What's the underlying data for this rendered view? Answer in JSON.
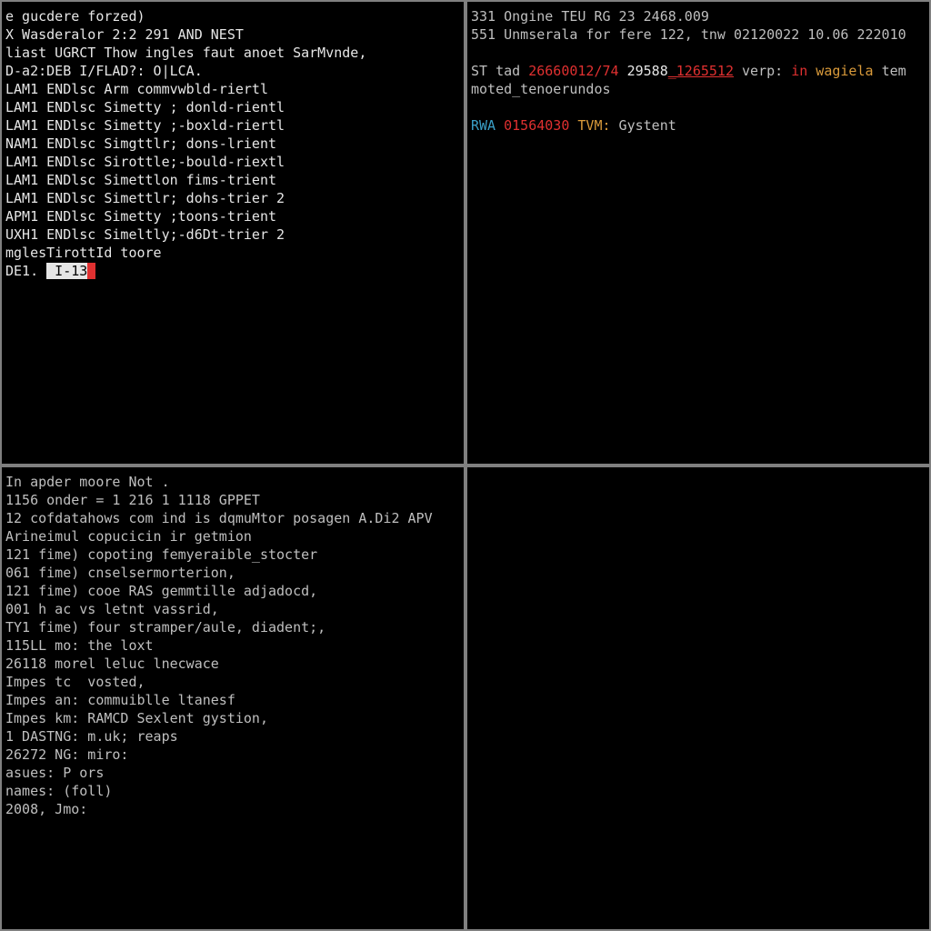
{
  "pane_tl": {
    "lines": [
      [
        {
          "t": "e gucdere forzed)",
          "c": "fg-white"
        }
      ],
      [
        {
          "t": "X Wasderalor 2:2 291 AND NEST",
          "c": "fg-white"
        }
      ],
      [
        {
          "t": "liast UGRCT Thow ingles faut anoet SarMvnde,",
          "c": "fg-white"
        }
      ],
      [
        {
          "t": "D-a2:DEB I/FLAD?: O|LCA.",
          "c": "fg-white"
        }
      ],
      [
        {
          "t": "LAM1 ENDlsc Arm commvwbld-riertl",
          "c": "fg-white"
        }
      ],
      [
        {
          "t": "LAM1 ENDlsc Simetty ; donld-rientl",
          "c": "fg-white"
        }
      ],
      [
        {
          "t": "LAM1 ENDlsc Simetty ;-boxld-riertl",
          "c": "fg-white"
        }
      ],
      [
        {
          "t": "NAM1 ENDlsc Simgttlr; dons-lrient",
          "c": "fg-white"
        }
      ],
      [
        {
          "t": "LAM1 ENDlsc Sirottle;-bould-riextl",
          "c": "fg-white"
        }
      ],
      [
        {
          "t": "LAM1 ENDlsc Simettlon fims-trient",
          "c": "fg-white"
        }
      ],
      [
        {
          "t": "LAM1 ENDlsc Simettlr; dohs-trier 2",
          "c": "fg-white"
        }
      ],
      [
        {
          "t": "APM1 ENDlsc Simetty ;toons-trient",
          "c": "fg-white"
        }
      ],
      [
        {
          "t": "UXH1 ENDlsc Simeltly;-d6Dt-trier 2",
          "c": "fg-white"
        }
      ],
      [
        {
          "t": "mglesTirottId toore",
          "c": "fg-white"
        }
      ],
      [
        {
          "t": "DE1. ",
          "c": "fg-white"
        },
        {
          "t": " I-13",
          "c": "bg-white"
        },
        {
          "t": " ",
          "c": "bg-red"
        }
      ]
    ]
  },
  "pane_tr": {
    "lines": [
      [
        {
          "t": "331 Ongine TEU RG 23 2468.009",
          "c": "fg-grey"
        }
      ],
      [
        {
          "t": "551 Unmserala for fere 122, tnw 02120022 10.06 222010",
          "c": "fg-grey"
        }
      ],
      [
        {
          "t": "",
          "c": ""
        }
      ],
      [
        {
          "t": "ST tad ",
          "c": "fg-grey"
        },
        {
          "t": "26660012/74",
          "c": "fg-red"
        },
        {
          "t": " 29588",
          "c": "fg-white"
        },
        {
          "t": "_1265512",
          "c": "fg-redul"
        },
        {
          "t": " verp: ",
          "c": "fg-grey"
        },
        {
          "t": "in",
          "c": "fg-red"
        },
        {
          "t": " wagiela ",
          "c": "fg-orange"
        },
        {
          "t": "tem",
          "c": "fg-grey"
        }
      ],
      [
        {
          "t": "moted",
          "c": "fg-grey"
        },
        {
          "t": "_tenoerundos",
          "c": "fg-grey"
        }
      ],
      [
        {
          "t": "",
          "c": ""
        }
      ],
      [
        {
          "t": "RWA ",
          "c": "fg-cyan"
        },
        {
          "t": "01564030 ",
          "c": "fg-red"
        },
        {
          "t": "TVM:",
          "c": "fg-orange"
        },
        {
          "t": " Gystent",
          "c": "fg-grey"
        }
      ]
    ]
  },
  "pane_bl": {
    "lines": [
      [
        {
          "t": "In apder moore Not .",
          "c": "fg-grey"
        }
      ],
      [
        {
          "t": "1156 onder = 1 216 1 1118 GPPET",
          "c": "fg-grey"
        }
      ],
      [
        {
          "t": "12 cofdatahows com ind is dqmuMtor posagen A.Di2 APV",
          "c": "fg-grey"
        }
      ],
      [
        {
          "t": "Arineimul copucicin ir getmion",
          "c": "fg-grey"
        }
      ],
      [
        {
          "t": "121 fime) copoting femyeraible_stocter",
          "c": "fg-grey"
        }
      ],
      [
        {
          "t": "061 fime) cnselsermorterion,",
          "c": "fg-grey"
        }
      ],
      [
        {
          "t": "121 fime) cooe RAS gemmtille adjadocd,",
          "c": "fg-grey"
        }
      ],
      [
        {
          "t": "001 h ac vs letnt vassrid,",
          "c": "fg-grey"
        }
      ],
      [
        {
          "t": "TY1 fime) four stramper/aule, diadent;,",
          "c": "fg-grey"
        }
      ],
      [
        {
          "t": "115LL mo: the loxt",
          "c": "fg-grey"
        }
      ],
      [
        {
          "t": "26118 morel leluc lnecwace",
          "c": "fg-grey"
        }
      ],
      [
        {
          "t": "Impes tc  vosted,",
          "c": "fg-grey"
        }
      ],
      [
        {
          "t": "Impes an: commuiblle ltanesf",
          "c": "fg-grey"
        }
      ],
      [
        {
          "t": "Impes km: RAMCD Sexlent gystion,",
          "c": "fg-grey"
        }
      ],
      [
        {
          "t": "1 DASTNG: m.uk; reaps",
          "c": "fg-grey"
        }
      ],
      [
        {
          "t": "26272 NG: miro:",
          "c": "fg-grey"
        }
      ],
      [
        {
          "t": "asues: P ors",
          "c": "fg-grey"
        }
      ],
      [
        {
          "t": "names: (foll)",
          "c": "fg-grey"
        }
      ],
      [
        {
          "t": "2008, Jmo:",
          "c": "fg-grey"
        }
      ]
    ]
  },
  "pane_br": {
    "lines": []
  }
}
